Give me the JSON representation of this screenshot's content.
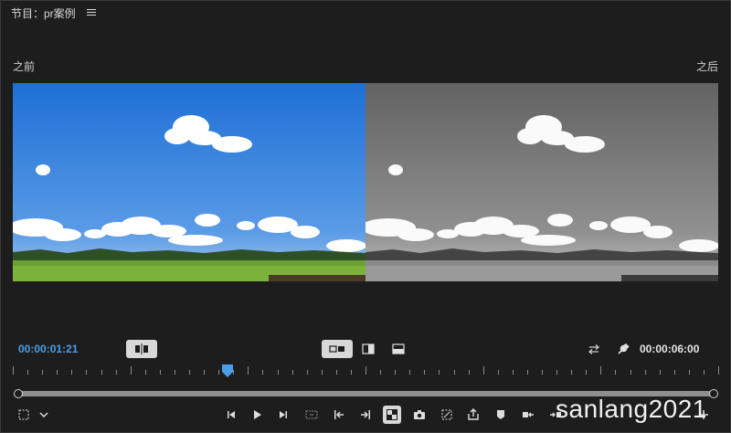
{
  "header": {
    "title": "节目：pr案例"
  },
  "labels": {
    "before": "之前",
    "after": "之后"
  },
  "timecode": {
    "current": "00:00:01:21",
    "duration": "00:00:06:00"
  },
  "watermark": "sanlang2021",
  "colors": {
    "background": "#1d1d1d",
    "accent_blue": "#4a9fe8",
    "sky_top": "#1e6fd6",
    "sky_bottom": "#5a9be6",
    "field_green": "#6aa033"
  },
  "icons": {
    "header_menu": "hamburger-icon",
    "compare_toggle": "compare-split-icon",
    "view_side_by_side": "side-by-side-icon",
    "view_vertical_split": "vertical-split-icon",
    "view_horizontal_split": "horizontal-split-icon",
    "swap": "swap-icon",
    "settings": "wrench-icon"
  },
  "toolbar": [
    "safe-margins-icon",
    "chevron-down-icon",
    "step-back-icon",
    "play-icon",
    "step-forward-icon",
    "trim-icon",
    "go-to-in-icon",
    "go-to-out-icon",
    "compare-view-icon",
    "camera-icon",
    "multicam-icon",
    "export-frame-icon",
    "marker-icon",
    "lift-icon",
    "extract-icon",
    "add-icon"
  ]
}
